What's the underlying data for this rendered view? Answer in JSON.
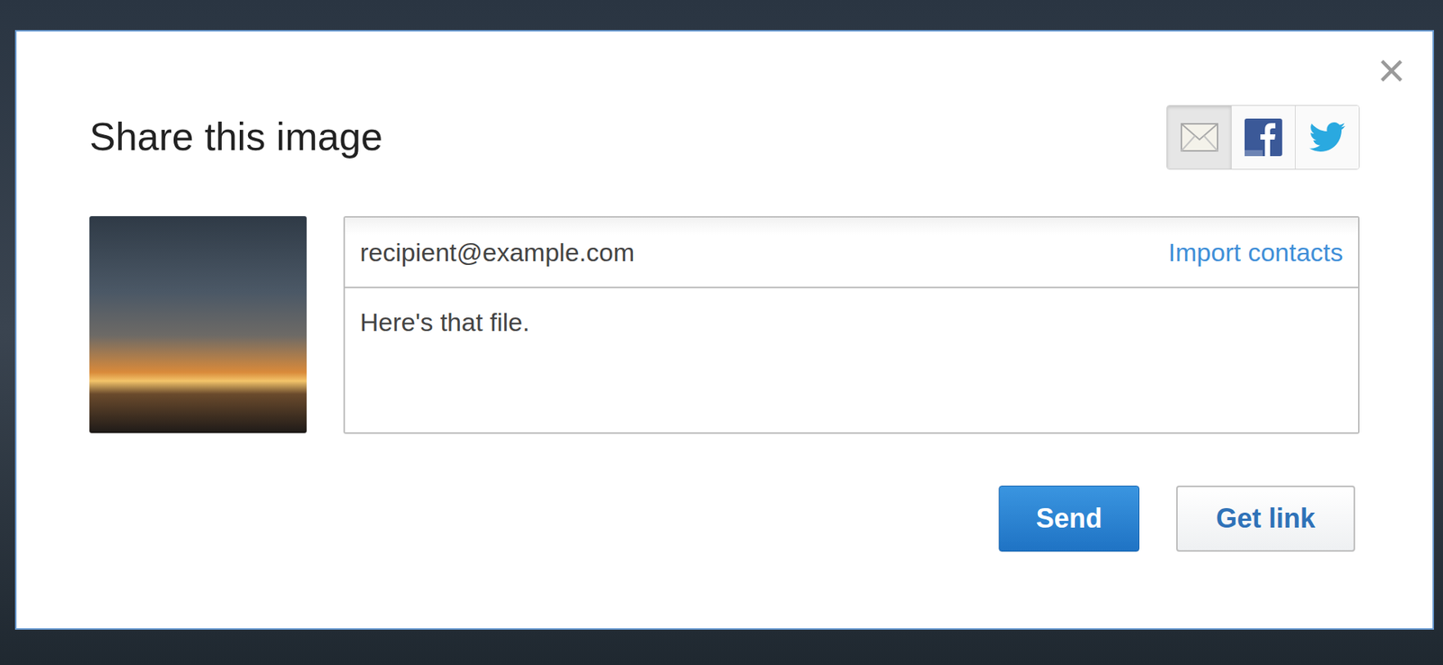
{
  "dialog": {
    "title": "Share this image",
    "close": "×"
  },
  "share_options": [
    {
      "kind": "email",
      "selected": true
    },
    {
      "kind": "facebook",
      "selected": false
    },
    {
      "kind": "twitter",
      "selected": false
    }
  ],
  "form": {
    "to": "recipient@example.com",
    "import_link": "Import contacts",
    "message": "Here's that file."
  },
  "buttons": [
    {
      "label": "Send",
      "kind": "primary"
    },
    {
      "label": "Get link",
      "kind": "secondary"
    }
  ]
}
